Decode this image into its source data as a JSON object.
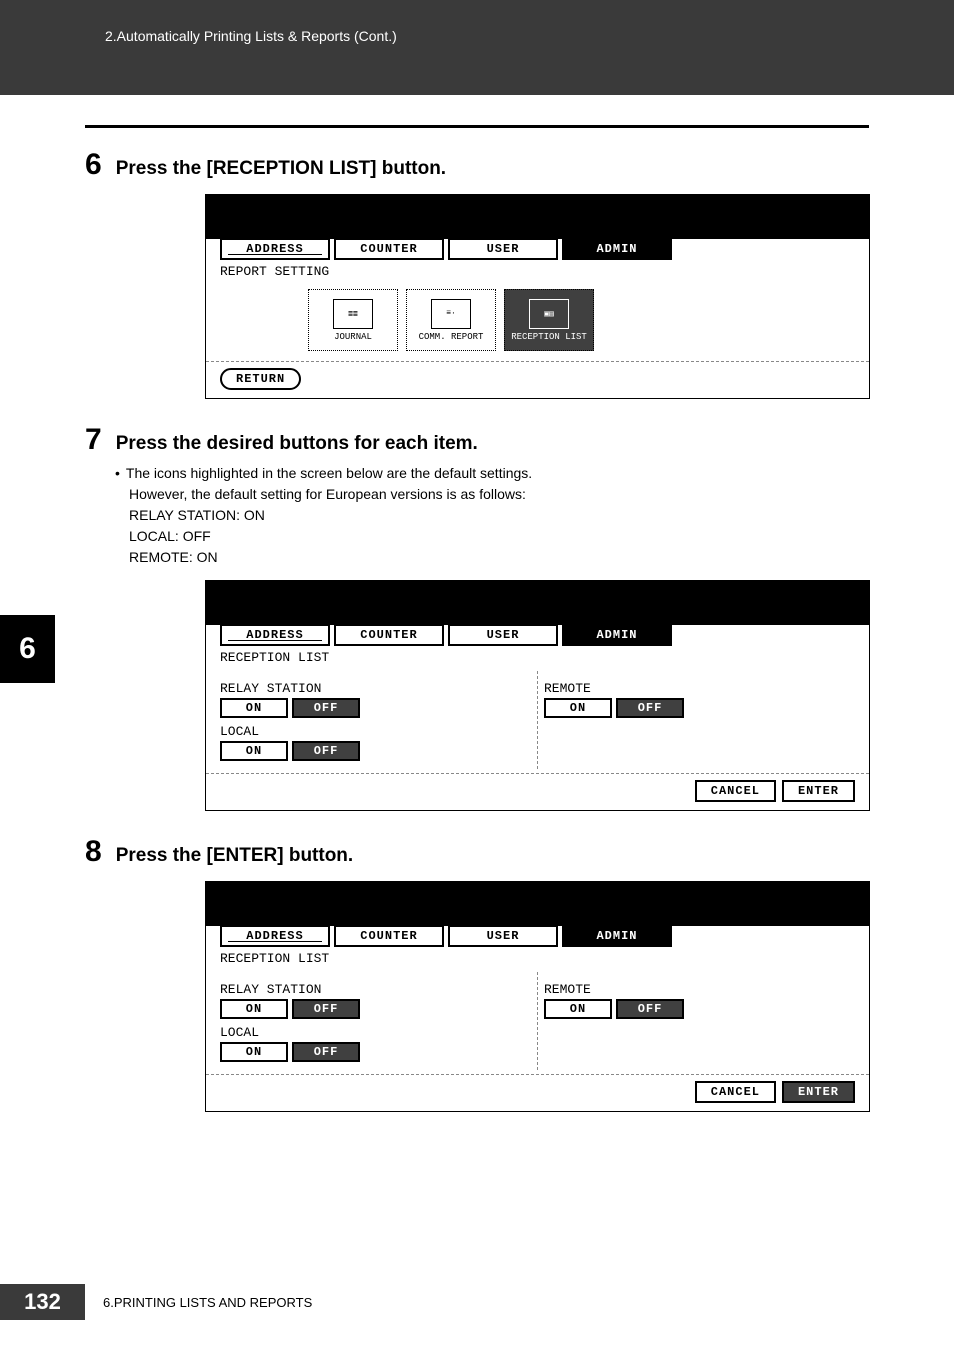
{
  "header": {
    "breadcrumb": "2.Automatically Printing Lists & Reports (Cont.)"
  },
  "sideTab": "6",
  "steps": {
    "s6": {
      "num": "6",
      "title": "Press the [RECEPTION LIST] button."
    },
    "s7": {
      "num": "7",
      "title": "Press the desired buttons for each item.",
      "bullet": "•",
      "note1": "The icons highlighted in the screen below are the default settings.",
      "note2": "However, the default setting for European versions is as follows:",
      "note3": "RELAY STATION: ON",
      "note4": "LOCAL: OFF",
      "note5": "REMOTE: ON"
    },
    "s8": {
      "num": "8",
      "title": "Press the [ENTER] button."
    }
  },
  "tabs": {
    "address": "ADDRESS",
    "counter": "COUNTER",
    "user": "USER",
    "admin": "ADMIN"
  },
  "screen1": {
    "sectionLabel": "REPORT SETTING",
    "icons": {
      "journal": "JOURNAL",
      "commReport": "COMM. REPORT",
      "receptionList": "RECEPTION LIST"
    },
    "return": "RETURN"
  },
  "screen2": {
    "sectionLabel": "RECEPTION LIST",
    "labels": {
      "relayStation": "RELAY STATION",
      "local": "LOCAL",
      "remote": "REMOTE"
    },
    "buttons": {
      "on": "ON",
      "off": "OFF",
      "cancel": "CANCEL",
      "enter": "ENTER"
    }
  },
  "footer": {
    "pageNum": "132",
    "chapter": "6.PRINTING LISTS AND REPORTS"
  }
}
